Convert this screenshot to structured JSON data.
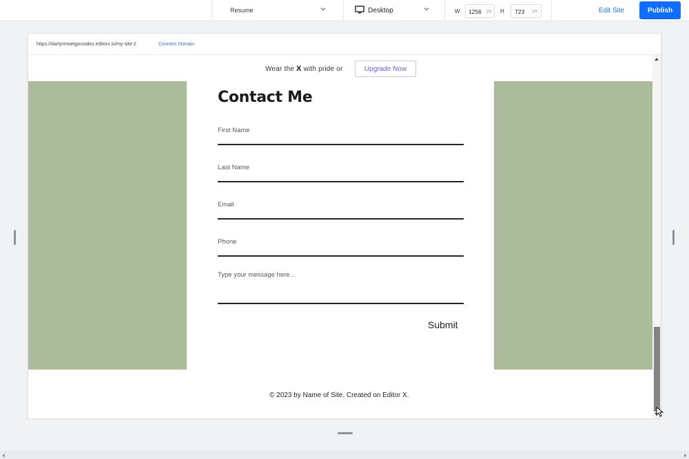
{
  "toolbar": {
    "page_select": "Resume",
    "device": "Desktop",
    "width_label": "W",
    "width_value": "1256",
    "width_unit": "px",
    "height_label": "H",
    "height_value": "723",
    "height_unit": "px",
    "edit_site": "Edit Site",
    "publish": "Publish"
  },
  "urlbar": {
    "url": "https://darlynmoetgonzalez.editorx.io/my-site-2",
    "connect_domain": "Connect Domain"
  },
  "banner": {
    "prefix": "Wear the",
    "brand": "X",
    "suffix": "with pride or",
    "upgrade": "Upgrade Now"
  },
  "form": {
    "title": "Contact Me",
    "first_name": "First Name",
    "last_name": "Last Name",
    "email": "Email",
    "phone": "Phone",
    "message_placeholder": "Type your message here...",
    "submit": "Submit"
  },
  "footer": {
    "text": "© 2023 by Name of Site. Created on Editor X."
  },
  "colors": {
    "accent": "#116dff",
    "panel_green": "#abbb9b",
    "link_blue": "#2a6fd6"
  }
}
